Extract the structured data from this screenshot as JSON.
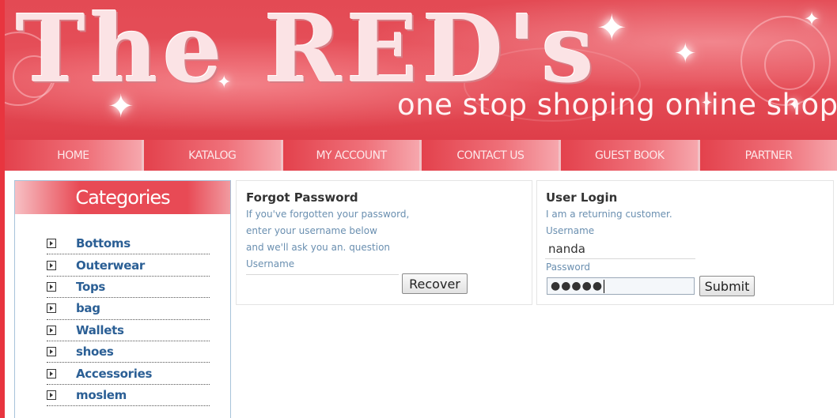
{
  "header": {
    "logo_text": "The RED's",
    "tagline": "one stop shoping online shop"
  },
  "nav": {
    "items": [
      {
        "label": "HOME"
      },
      {
        "label": "KATALOG"
      },
      {
        "label": "MY ACCOUNT"
      },
      {
        "label": "CONTACT US"
      },
      {
        "label": "GUEST BOOK"
      },
      {
        "label": "PARTNER"
      }
    ]
  },
  "sidebar": {
    "title": "Categories",
    "items": [
      {
        "label": "Bottoms"
      },
      {
        "label": "Outerwear"
      },
      {
        "label": "Tops"
      },
      {
        "label": "bag"
      },
      {
        "label": "Wallets"
      },
      {
        "label": "shoes"
      },
      {
        "label": "Accessories"
      },
      {
        "label": "moslem"
      }
    ]
  },
  "forgot": {
    "title": "Forgot Password",
    "line1": "If you've forgotten your password,",
    "line2": "enter your username below",
    "line3": "and we'll ask you an. question",
    "username_label": "Username",
    "username_value": "",
    "button_label": "Recover"
  },
  "login": {
    "title": "User Login",
    "subtitle": "I am a returning customer.",
    "username_label": "Username",
    "username_value": "nanda",
    "password_label": "Password",
    "password_masked": "●●●●●",
    "button_label": "Submit"
  },
  "colors": {
    "brand_red": "#e84a55",
    "link_blue": "#2b5f95",
    "hint_blue": "#6a8fb0"
  },
  "icons": {
    "category_bullet": "arrow-box-icon",
    "sparkle": "sparkle-icon"
  }
}
